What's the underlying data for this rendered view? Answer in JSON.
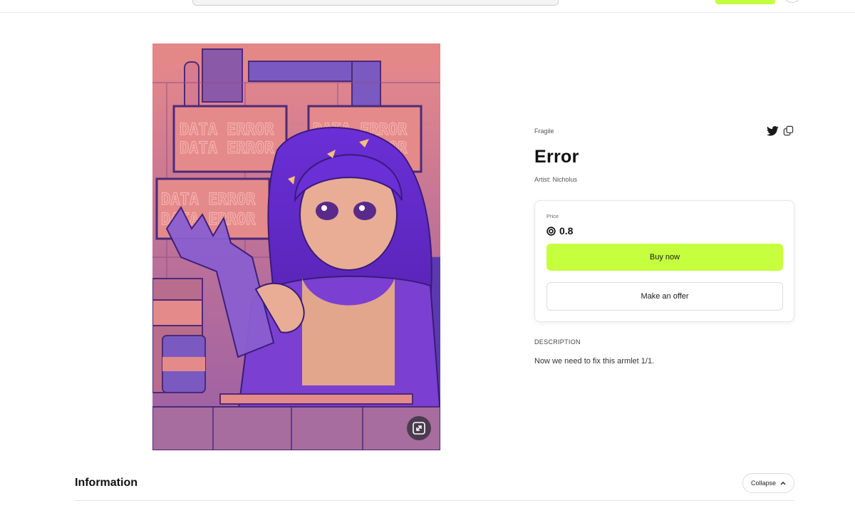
{
  "nft": {
    "collection": "Fragile",
    "title": "Error",
    "artist": "Artist: Nicholus",
    "artwork": {
      "alt_text_visible_in_art": "DATA ERROR"
    }
  },
  "price": {
    "label": "Price",
    "value": "0.8",
    "currency_icon": "currency-circle-icon"
  },
  "actions": {
    "buy_label": "Buy now",
    "offer_label": "Make an offer"
  },
  "description": {
    "heading": "DESCRIPTION",
    "text": "Now we need to fix this armlet 1/1."
  },
  "information": {
    "title": "Information",
    "collapse_label": "Collapse"
  },
  "colors": {
    "accent": "#c5ff3d",
    "art_pink": "#e58a8a",
    "art_purple": "#7b3fd1"
  }
}
